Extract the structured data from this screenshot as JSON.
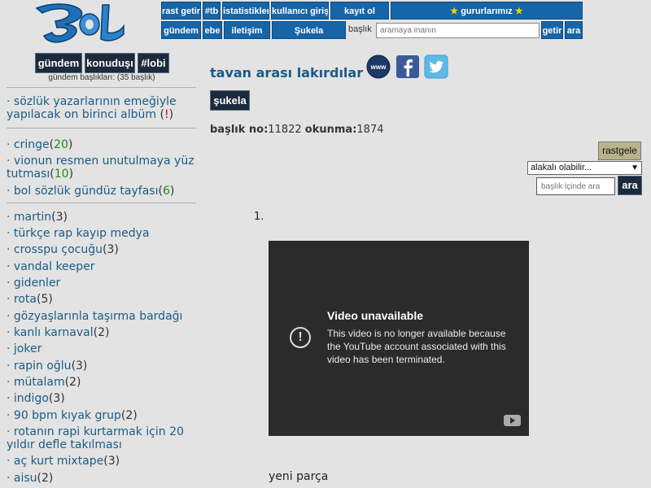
{
  "nav": {
    "row1": [
      "rast getir",
      "#tb",
      "istatistikler",
      "kullanıcı girişi",
      "kayıt ol"
    ],
    "gururlarimiz": "gururlarımız",
    "row2": [
      "gündem",
      "ebe",
      "iletişim",
      "Şukela"
    ],
    "search_label": "başlık",
    "search_placeholder": "aramaya inanın",
    "getir": "getir",
    "ara": "ara"
  },
  "sidebar": {
    "tabs": [
      "gündem",
      "konuduşı",
      "#lobi"
    ],
    "subtitle": "gündem başlıkları: (35 başlık)",
    "featured": {
      "text": "sözlük yazarlarının emeğiyle yapılacak on birinci albüm",
      "badge": "!"
    },
    "pinned": [
      {
        "text": "cringe",
        "count": "20"
      },
      {
        "text": "vionun resmen unutulmaya yüz tutması",
        "count": "10"
      },
      {
        "text": "bol sözlük gündüz tayfası",
        "count": "6"
      }
    ],
    "items": [
      {
        "text": "martin",
        "count": "(3)"
      },
      {
        "text": "türkçe rap kayıp medya",
        "count": ""
      },
      {
        "text": "crosspu çocuğu",
        "count": "(3)"
      },
      {
        "text": "vandal keeper",
        "count": ""
      },
      {
        "text": "gidenler",
        "count": ""
      },
      {
        "text": "rota",
        "count": "(5)"
      },
      {
        "text": "gözyaşlarınla taşırma bardağı",
        "count": ""
      },
      {
        "text": "kanlı karnaval",
        "count": "(2)"
      },
      {
        "text": "joker",
        "count": ""
      },
      {
        "text": "rapin oğlu",
        "count": "(3)"
      },
      {
        "text": "mütalam",
        "count": "(2)"
      },
      {
        "text": "indigo",
        "count": "(3)"
      },
      {
        "text": "90 bpm kıyak grup",
        "count": "(2)"
      },
      {
        "text": "rotanın rapi kurtarmak için 20 yıldır defle takılması",
        "count": ""
      },
      {
        "text": "aç kurt mixtape",
        "count": "(3)"
      },
      {
        "text": "aisu",
        "count": "(2)"
      }
    ]
  },
  "main": {
    "title": "tavan arası lakırdılar",
    "social": [
      "www-icon",
      "facebook-icon",
      "twitter-icon"
    ],
    "www_text": "www",
    "sukela": "şukela",
    "meta_baslik_label": "başlık no:",
    "meta_baslik_value": "11822",
    "meta_okunma_label": "okunma:",
    "meta_okunma_value": "1874",
    "rastgele": "rastgele",
    "alakali": "alakalı olabilir...",
    "in_search_placeholder": "başlık içinde ara",
    "in_ara": "ara",
    "entry_number": "1.",
    "video": {
      "title": "Video unavailable",
      "body": "This video is no longer available because the YouTube account associated with this video has been terminated."
    },
    "entry_text": "yeni parça"
  },
  "colors": {
    "accent": "#1565a8",
    "link": "#1a5b86",
    "dark_button": "#1b2a3c",
    "count_green": "#1c8a1c"
  }
}
